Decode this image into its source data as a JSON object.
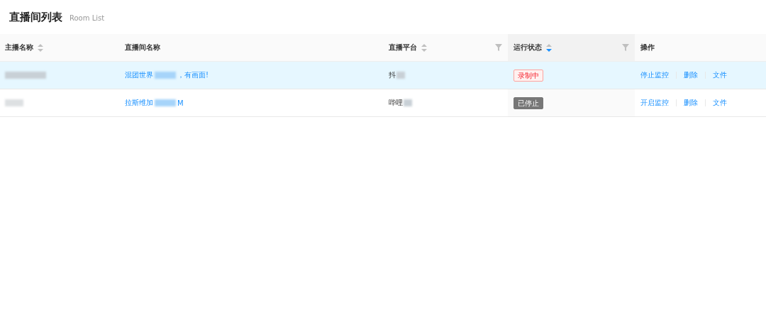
{
  "page": {
    "title": "直播间列表",
    "subtitle": "Room List"
  },
  "table": {
    "columns": [
      {
        "label": "主播名称",
        "sortable": true,
        "sorted_descending": false,
        "filterable": false
      },
      {
        "label": "直播间名称",
        "sortable": false,
        "filterable": false
      },
      {
        "label": "直播平台",
        "sortable": true,
        "sorted_descending": false,
        "filterable": true
      },
      {
        "label": "运行状态",
        "sortable": true,
        "sorted_descending": true,
        "filterable": true
      },
      {
        "label": "操作",
        "sortable": false,
        "filterable": false
      }
    ],
    "rows": [
      {
        "selected": true,
        "streamer": {
          "blurred": true
        },
        "room": {
          "before": "混团世界",
          "after": "，有画面!"
        },
        "platform": {
          "text": "抖",
          "blurred": true
        },
        "status": {
          "kind": "recording",
          "label": "录制中"
        },
        "actions": [
          "停止监控",
          "删除",
          "文件"
        ]
      },
      {
        "selected": false,
        "streamer": {
          "blurred": true
        },
        "room": {
          "before": "拉斯维加",
          "after": "M"
        },
        "platform": {
          "text": "哔哩",
          "blurred": true
        },
        "status": {
          "kind": "stopped",
          "label": "已停止"
        },
        "actions": [
          "开启监控",
          "删除",
          "文件"
        ]
      }
    ]
  }
}
